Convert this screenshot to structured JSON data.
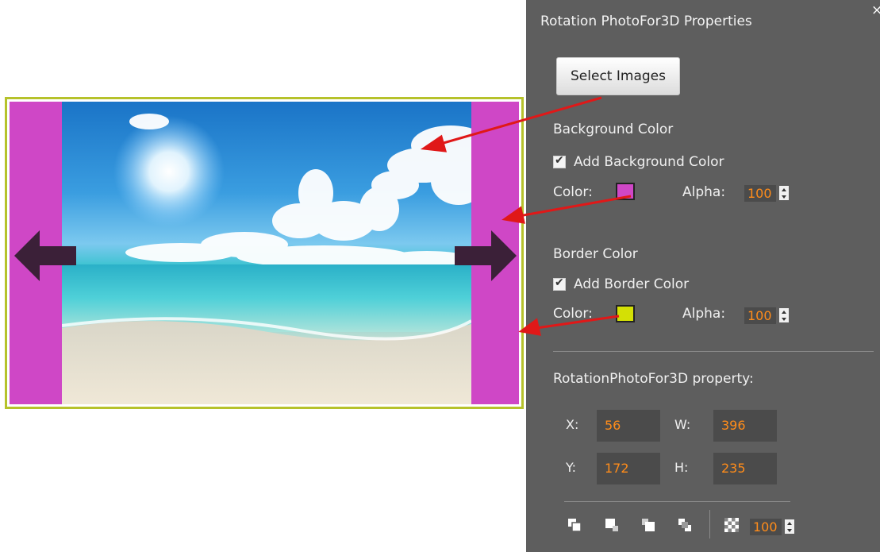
{
  "panel": {
    "title": "Rotation PhotoFor3D Properties",
    "close_label": "×",
    "select_images_label": "Select Images",
    "background": {
      "heading": "Background Color",
      "checkbox_label": "Add Background Color",
      "checked": true,
      "color_label": "Color:",
      "color_value": "#cf47c6",
      "alpha_label": "Alpha:",
      "alpha_value": "100"
    },
    "border": {
      "heading": "Border Color",
      "checkbox_label": "Add Border Color",
      "checked": true,
      "color_label": "Color:",
      "color_value": "#d4e005",
      "alpha_label": "Alpha:",
      "alpha_value": "100"
    },
    "property": {
      "heading": "RotationPhotoFor3D property:",
      "x_label": "X:",
      "x_value": "56",
      "w_label": "W:",
      "w_value": "396",
      "y_label": "Y:",
      "y_value": "172",
      "h_label": "H:",
      "h_value": "235"
    },
    "toolbar": {
      "tools": [
        "bring-to-front-icon",
        "bring-forward-icon",
        "send-backward-icon",
        "send-to-back-icon"
      ],
      "opacity_icon": "opacity-checker-icon",
      "opacity_value": "100"
    }
  },
  "preview": {
    "background_color": "#cf47c6",
    "border_color": "#b6c22b",
    "left_arrow_icon": "arrow-left-icon",
    "right_arrow_icon": "arrow-right-icon"
  },
  "colors": {
    "panel_bg": "#5e5e5e",
    "value_text": "#ff8c1a",
    "annotation_arrow": "#e01818"
  }
}
